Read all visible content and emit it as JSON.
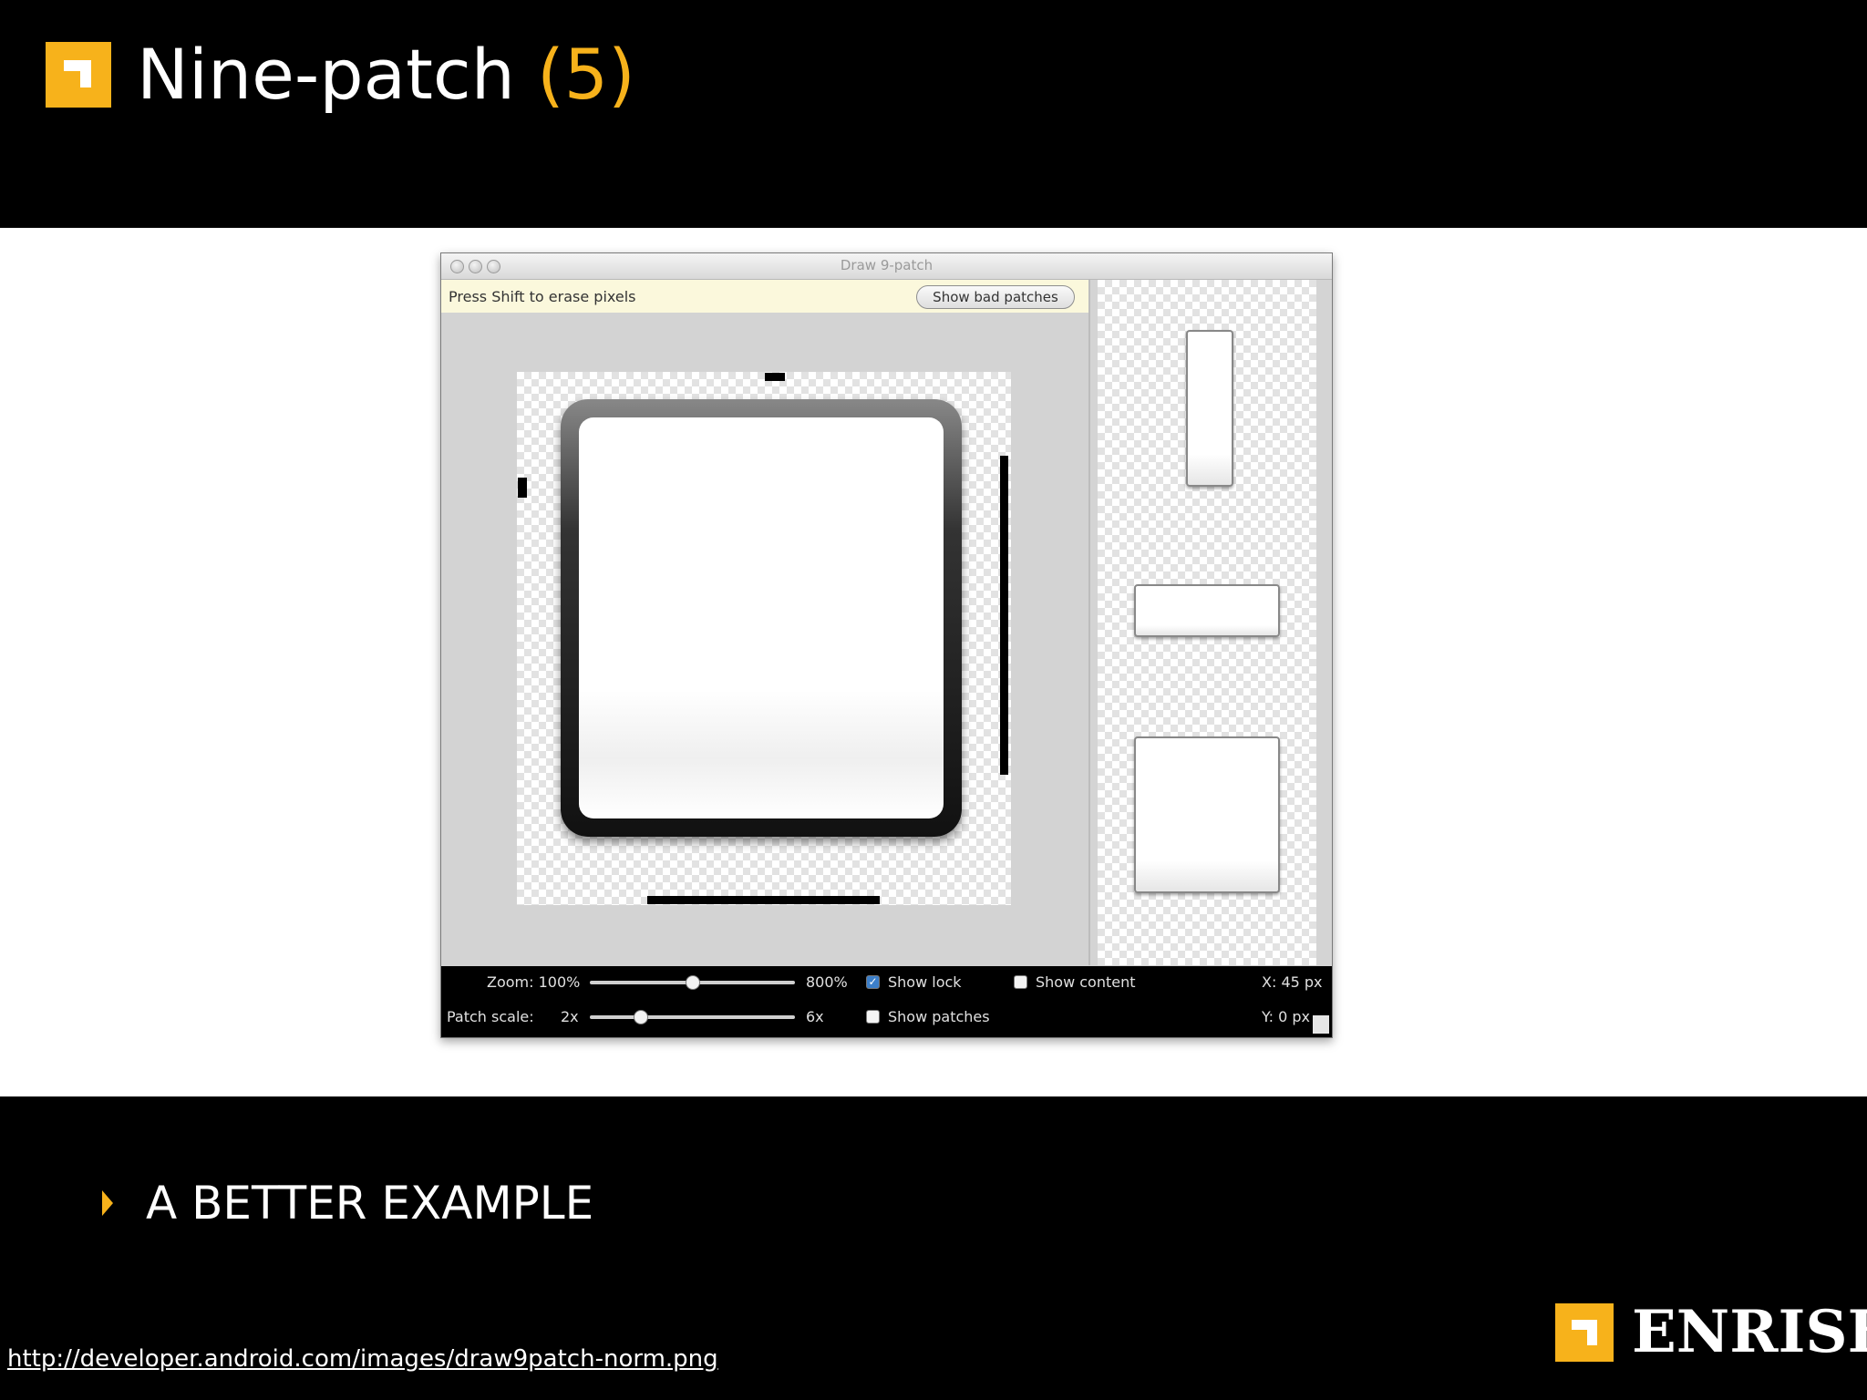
{
  "slide": {
    "title_main": "Nine-patch",
    "title_number": "(5)",
    "bullet": "A BETTER EXAMPLE",
    "source_url": "http://developer.android.com/images/draw9patch-norm.png",
    "logo_text": "ENRISE",
    "accent_color": "#f7b21b"
  },
  "app": {
    "window_title": "Draw 9-patch",
    "hint": "Press Shift to erase pixels",
    "show_bad_patches": "Show bad patches",
    "zoom_label": "Zoom: 100%",
    "zoom_max": "800%",
    "zoom_level": 0.5,
    "patch_scale_label": "Patch scale:",
    "patch_scale_min": "2x",
    "patch_scale_max": "6x",
    "patch_scale_level": 0.25,
    "show_lock": "Show lock",
    "show_lock_checked": true,
    "show_content": "Show content",
    "show_content_checked": false,
    "show_patches": "Show patches",
    "show_patches_checked": false,
    "x_readout": "X: 45 px",
    "y_readout": "Y:   0 px"
  }
}
